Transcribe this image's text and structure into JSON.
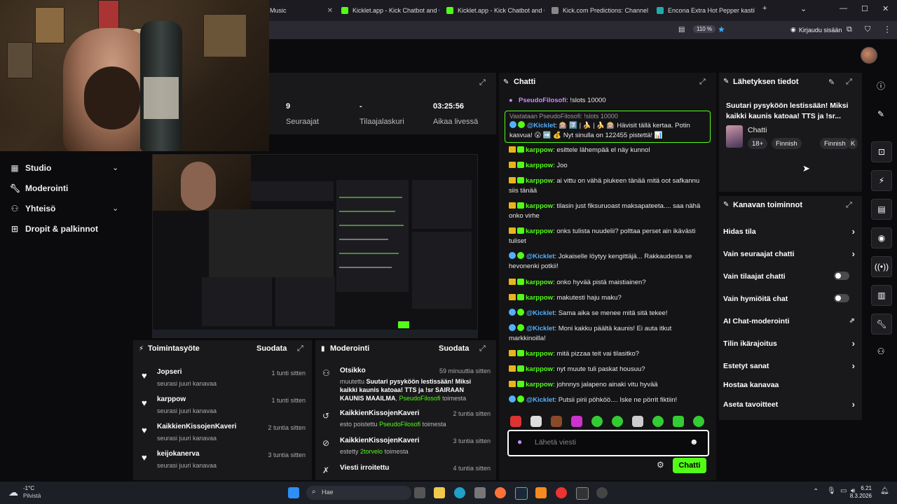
{
  "browser": {
    "tabs": [
      {
        "label": "Music"
      },
      {
        "label": "Kicklet.app - Kick Chatbot and C"
      },
      {
        "label": "Kicklet.app - Kick Chatbot and C"
      },
      {
        "label": "Kick.com Predictions: Channel P"
      },
      {
        "label": "Encona Extra Hot Pepper kastike"
      }
    ],
    "zoom": "110 %",
    "signin": "Kirjaudu sisään"
  },
  "stats": {
    "followers_value": "9",
    "followers_label": "Seuraajat",
    "subs_value": "-",
    "subs_label": "Tilaajalaskuri",
    "live_value": "03:25:56",
    "live_label": "Aikaa livessä"
  },
  "nav": {
    "items": [
      {
        "label": "Studio"
      },
      {
        "label": "Moderointi"
      },
      {
        "label": "Yhteisö"
      },
      {
        "label": "Dropit & palkinnot"
      }
    ]
  },
  "activity": {
    "title": "Toimintasyöte",
    "filter": "Suodata",
    "rows": [
      {
        "name": "Jopseri",
        "sub": "seurasi juuri kanavaa",
        "time": "1 tunti sitten"
      },
      {
        "name": "karppow",
        "sub": "seurasi juuri kanavaa",
        "time": "1 tunti sitten"
      },
      {
        "name": "KaikkienKissojenKaveri",
        "sub": "seurasi juuri kanavaa",
        "time": "2 tuntia sitten"
      },
      {
        "name": "keijokanerva",
        "sub": "seurasi juuri kanavaa",
        "time": "3 tuntia sitten"
      }
    ]
  },
  "moderation": {
    "title": "Moderointi",
    "filter": "Suodata",
    "rows": [
      {
        "name": "Otsikko",
        "time": "59 minuuttia sitten",
        "pre": "muutettu",
        "bold": "Suutari pysyköön lestissään! Miksi kaikki kaunis katoaa! TTS ja !sr SAIRAAN KAUNIS MAAILMA",
        "user": "PseudoFilosofi",
        "post": "toimesta"
      },
      {
        "name": "KaikkienKissojenKaveri",
        "time": "2 tuntia sitten",
        "pre": "esto poistettu",
        "user": "PseudoFilosofi",
        "post": "toimesta"
      },
      {
        "name": "KaikkienKissojenKaveri",
        "time": "3 tuntia sitten",
        "pre": "estetty",
        "user": "2torvelo",
        "post": "toimesta"
      },
      {
        "name": "Viesti irroitettu",
        "time": "4 tuntia sitten"
      }
    ]
  },
  "chat": {
    "title": "Chatti",
    "top_user": "PseudoFilosofi",
    "top_text": ": !slots 10000",
    "pinned_reply": "Vastataan PseudoFilosofi: !slots 10000",
    "pinned_user": "@Kicklet",
    "pinned_text": ": 🎰 7️⃣ | 🍌 | 🍌 🎰 Hävisit tällä kertaa. Potin kasvua! 😮 ➡️ 💰 Nyt sinulla on 122455 pistettä! 📊",
    "messages": [
      {
        "user": "karppow",
        "type": "sub",
        "text": ": esittele lähempää el näy kunnol"
      },
      {
        "user": "karppow",
        "type": "sub",
        "text": ": Joo"
      },
      {
        "user": "karppow",
        "type": "sub",
        "text": ": ai vittu on vähä piukeen tänää mitä oot safkannu siis tänää"
      },
      {
        "user": "karppow",
        "type": "sub",
        "text": ": tilasin just fiksuruoast maksapateeta.... saa nähä onko virhe"
      },
      {
        "user": "karppow",
        "type": "sub",
        "text": ": onks tulista nuudelii? polttaa perset ain ikävästi tuliset"
      },
      {
        "user": "@Kicklet",
        "type": "bot",
        "text": ": Jokaiselle löytyy kengittäjä... Rakkaudesta se hevonenki potkii!"
      },
      {
        "user": "karppow",
        "type": "sub",
        "text": ": onko hyvää pistä maistiainen?"
      },
      {
        "user": "karppow",
        "type": "sub",
        "text": ": makutesti haju maku?"
      },
      {
        "user": "@Kicklet",
        "type": "bot",
        "text": ": Sama aika se menee mitä sitä tekee!"
      },
      {
        "user": "@Kicklet",
        "type": "bot",
        "text": ": Moni kakku päältä kaunis! Ei auta itkut markkinoilla!"
      },
      {
        "user": "karppow",
        "type": "sub",
        "text": ": mitä pizzaa teit vai tilasitko?"
      },
      {
        "user": "karppow",
        "type": "sub",
        "text": ": nyt muute tuli paskat housuu?"
      },
      {
        "user": "karppow",
        "type": "sub",
        "text": ": johnnys jalapeno ainaki vitu hyvää"
      },
      {
        "user": "@Kicklet",
        "type": "bot",
        "text": ": Putsii pirii pöhköö.... Iske ne pörrit fiktiin!"
      }
    ],
    "input_placeholder": "Lähetä viesti",
    "send_label": "Chatti"
  },
  "stream_info": {
    "title": "Lähetyksen tiedot",
    "stream_title": "Suutari pysyköön lestissään! Miksi kaikki kaunis katoaa! TTS ja !sr...",
    "category": "Chatti",
    "tags": [
      "18+",
      "Finnish",
      "Finnish",
      "K"
    ]
  },
  "channel_actions": {
    "title": "Kanavan toiminnot",
    "rows": [
      {
        "label": "Hidas tila",
        "kind": "chev"
      },
      {
        "label": "Vain seuraajat chatti",
        "kind": "chev"
      },
      {
        "label": "Vain tilaajat chatti",
        "kind": "toggle"
      },
      {
        "label": "Vain hymiöitä chat",
        "kind": "toggle"
      },
      {
        "label": "AI Chat-moderointi",
        "kind": "ext"
      },
      {
        "label": "Tilin ikärajoitus",
        "kind": "chev"
      },
      {
        "label": "Estetyt sanat",
        "kind": "chev"
      },
      {
        "label": "Hostaa kanavaa",
        "kind": "none"
      },
      {
        "label": "Aseta tavoitteet",
        "kind": "chev"
      }
    ]
  },
  "taskbar": {
    "weather_temp": "-1°C",
    "weather_desc": "Pilvistä",
    "search": "Hae",
    "time": "6.21",
    "date": "8.3.2026"
  },
  "colors": {
    "accent": "#53fc18",
    "bot": "#53b0fc",
    "crown": "#e8b618"
  }
}
